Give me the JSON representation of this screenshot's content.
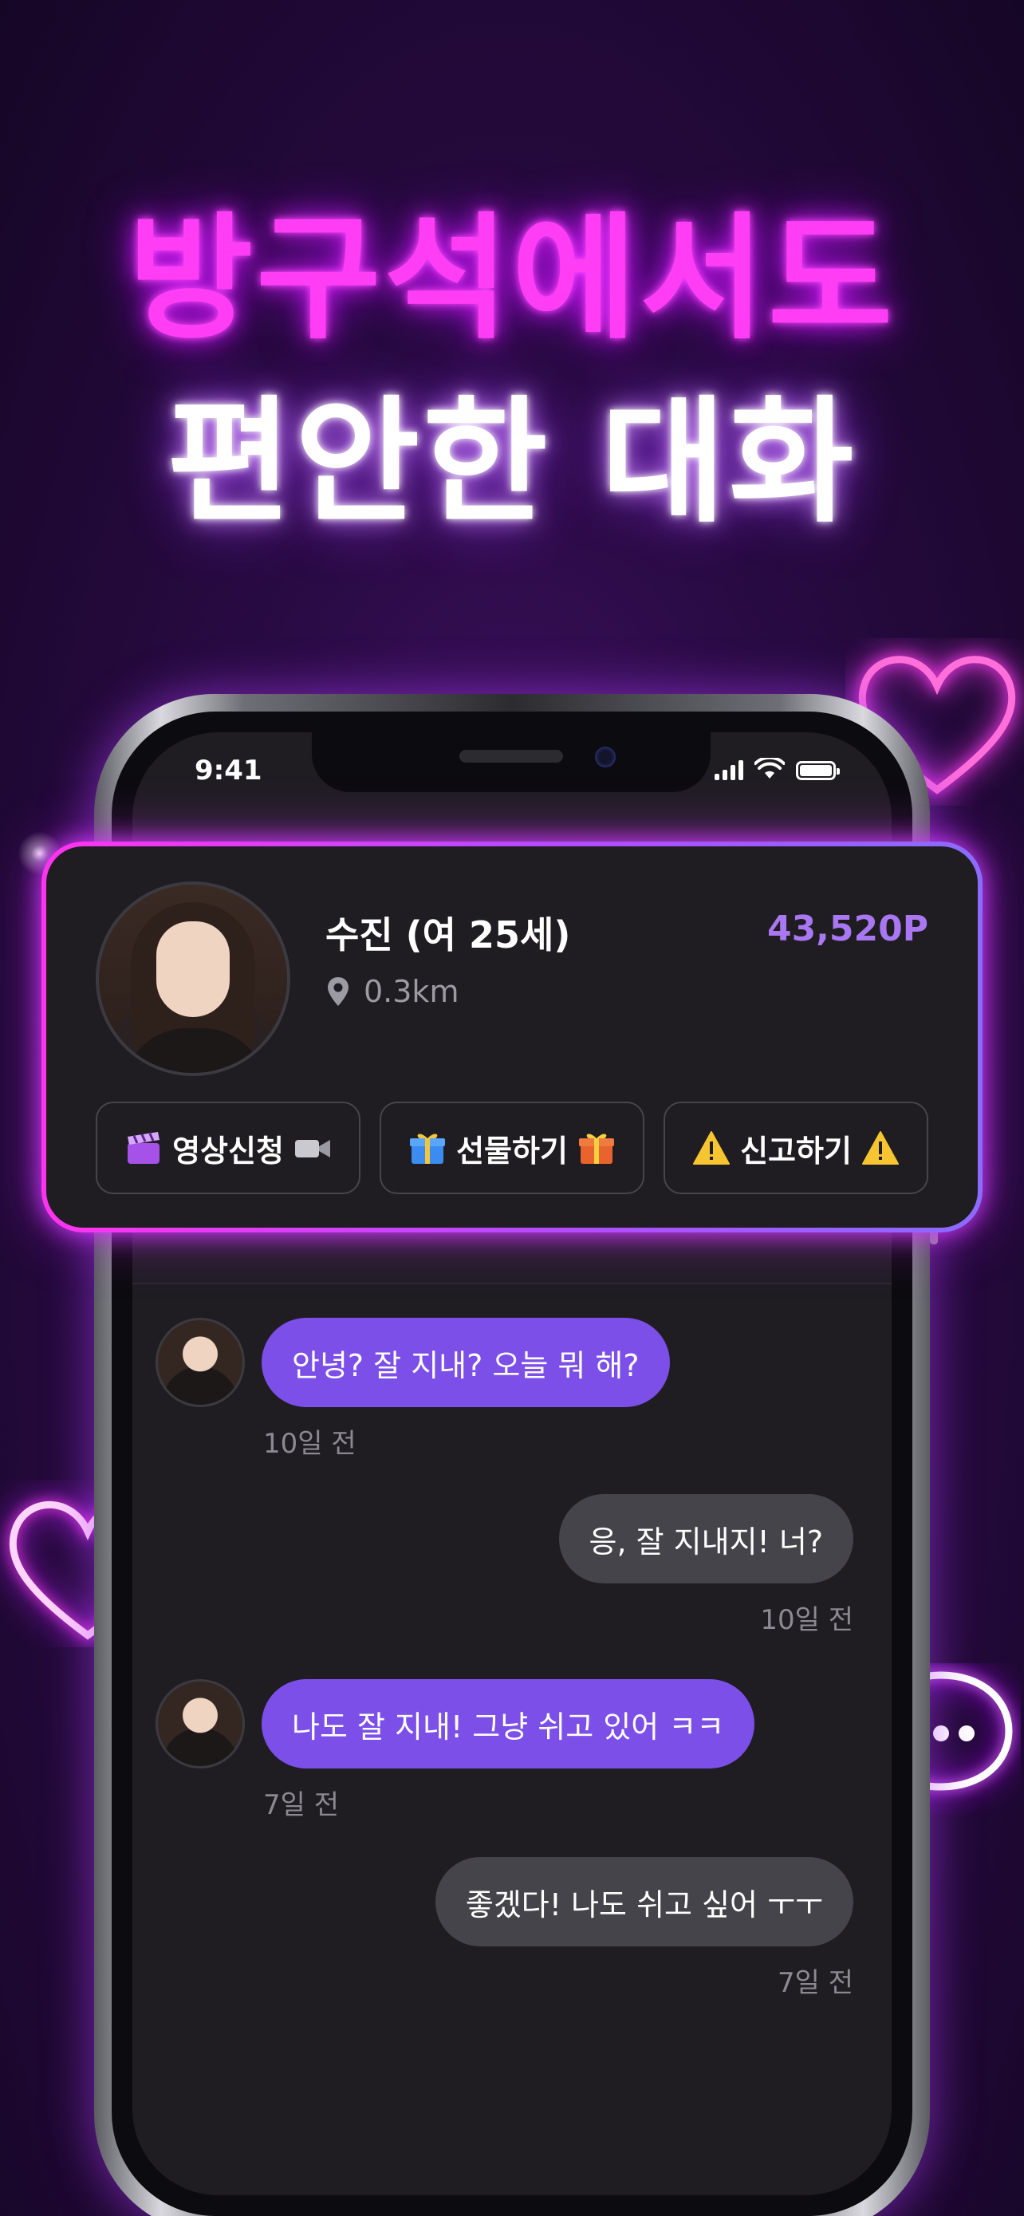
{
  "headline": {
    "line1": "방구석에서도",
    "line2": "편안한 대화"
  },
  "status_bar": {
    "time": "9:41"
  },
  "profile": {
    "name": "수진 (여 25세)",
    "distance": "0.3km",
    "points": "43,520P",
    "actions": [
      {
        "label": "영상신청",
        "icon_left": "clapper-board-icon",
        "icon_right": "video-camera-icon"
      },
      {
        "label": "선물하기",
        "icon_left": "gift-icon",
        "icon_right": "gift-icon"
      },
      {
        "label": "신고하기",
        "icon_left": "warning-icon",
        "icon_right": "warning-icon"
      }
    ]
  },
  "chat": {
    "messages": [
      {
        "side": "in",
        "text": "안녕? 잘 지내? 오늘 뭐 해?",
        "time": "10일 전"
      },
      {
        "side": "out",
        "text": "응, 잘 지내지! 너?",
        "time": "10일 전"
      },
      {
        "side": "in",
        "text": "나도 잘 지내! 그냥 쉬고 있어 ㅋㅋ",
        "time": "7일 전"
      },
      {
        "side": "out",
        "text": "좋겠다! 나도 쉬고 싶어 ㅜㅜ",
        "time": "7일 전"
      }
    ]
  },
  "colors": {
    "neon_pink": "#ff3df5",
    "points_purple": "#a977f2",
    "bubble_in": "#7b4fe8",
    "bubble_out": "#46444b"
  }
}
